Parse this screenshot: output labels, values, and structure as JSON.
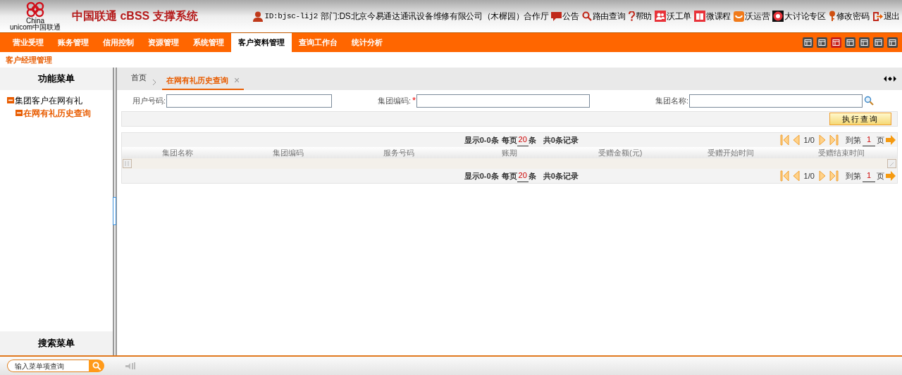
{
  "header": {
    "logo": {
      "line_1": "China",
      "line_2": "unicom",
      "brand": "中国联通"
    },
    "title": "中国联通 cBSS 支撑系统",
    "user_id": "ID:bjsc-lij2",
    "department": "部门:DS北京今易通达通讯设备维修有限公司（木樨园）合作厅",
    "links": [
      {
        "label": "公告",
        "kind": "notice"
      },
      {
        "label": "路由查询",
        "kind": "search"
      },
      {
        "label": "帮助",
        "kind": "help"
      },
      {
        "label": "沃工单",
        "kind": "people"
      },
      {
        "label": "微课程",
        "kind": "book"
      },
      {
        "label": "沃运营",
        "kind": "smile"
      },
      {
        "label": "大讨论专区",
        "kind": "forum"
      },
      {
        "label": "修改密码",
        "kind": "key"
      },
      {
        "label": "退出",
        "kind": "exit"
      }
    ]
  },
  "nav": {
    "tabs": [
      {
        "label": "营业受理",
        "selected": false
      },
      {
        "label": "账务管理",
        "selected": false
      },
      {
        "label": "信用控制",
        "selected": false
      },
      {
        "label": "资源管理",
        "selected": false
      },
      {
        "label": "系统管理",
        "selected": false
      },
      {
        "label": "客户资料管理",
        "selected": true
      },
      {
        "label": "查询工作台",
        "selected": false
      },
      {
        "label": "统计分析",
        "selected": false
      }
    ]
  },
  "section_title": "客户经理管理",
  "sidebar": {
    "title": "功能菜单",
    "tree": [
      {
        "label": "集团客户在网有礼",
        "expanded": true,
        "selected": false,
        "children": [
          {
            "label": "在网有礼历史查询",
            "expanded": true,
            "selected": true
          }
        ]
      }
    ],
    "footer_title": "搜索菜单"
  },
  "tabs": {
    "home": "首页",
    "items": [
      {
        "label": "在网有礼历史查询",
        "selected": true,
        "close": "×"
      }
    ]
  },
  "form": {
    "fields": [
      {
        "label": "用户号码:",
        "kind": "text"
      },
      {
        "label": "集团编码:",
        "required_mark": "*",
        "kind": "text"
      },
      {
        "label": "集团名称:",
        "kind": "search"
      }
    ],
    "submit": "执行查询"
  },
  "pagers": [
    {
      "showing": "显示0-0条",
      "per_page_label": "每页",
      "per_page": "20",
      "unit": "条",
      "total": "共0条记录",
      "page": "1/0",
      "goto_label": "到第",
      "goto_page": "1",
      "goto_unit": "页"
    },
    {
      "showing": "显示0-0条",
      "per_page_label": "每页",
      "per_page": "20",
      "unit": "条",
      "total": "共0条记录",
      "page": "1/0",
      "goto_label": "到第",
      "goto_page": "1",
      "goto_unit": "页"
    }
  ],
  "table": {
    "columns": [
      "集团名称",
      "集团编码",
      "服务号码",
      "账期",
      "受赠金额(元)",
      "受赠开始时间",
      "受赠结束时间"
    ]
  },
  "footer": {
    "search_placeholder": "输入菜单项查询"
  }
}
